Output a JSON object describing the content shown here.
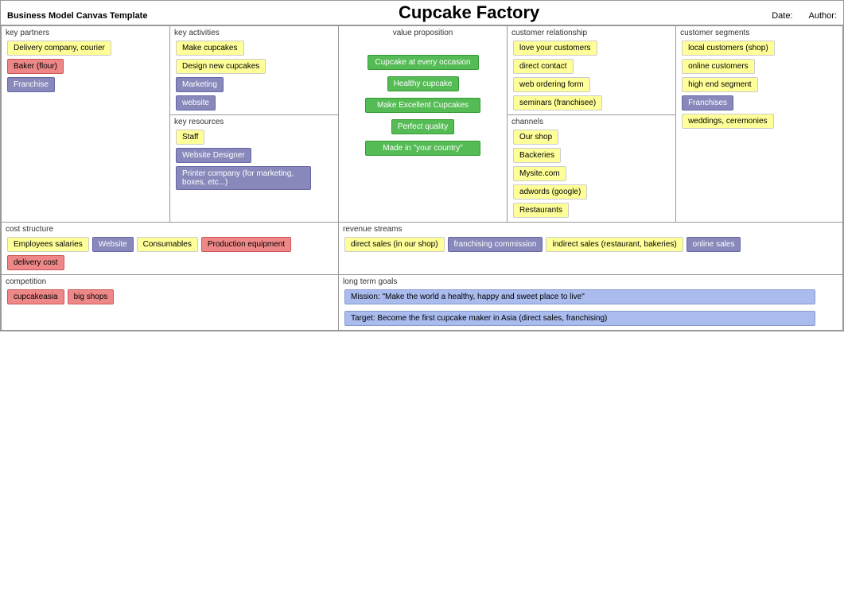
{
  "app": {
    "title": "Business Model Canvas Template"
  },
  "canvas": {
    "title": "Cupcake Factory",
    "date_label": "Date:",
    "author_label": "Author:"
  },
  "sections": {
    "key_partners": "key partners",
    "key_activities": "key activities",
    "value_proposition": "value proposition",
    "customer_relationship": "customer relationship",
    "customer_segments": "customer segments",
    "key_resources": "key resources",
    "channels": "channels",
    "cost_structure": "cost structure",
    "revenue_streams": "revenue streams",
    "competition": "competition",
    "long_term_goals": "long term goals"
  },
  "key_partners": [
    {
      "label": "Delivery company, courier",
      "type": "y"
    },
    {
      "label": "Baker (flour)",
      "type": "r"
    },
    {
      "label": "Franchise",
      "type": "b"
    }
  ],
  "key_activities": [
    {
      "label": "Make cupcakes",
      "type": "y"
    },
    {
      "label": "Design new cupcakes",
      "type": "y"
    },
    {
      "label": "Marketing",
      "type": "b"
    },
    {
      "label": "website",
      "type": "b"
    }
  ],
  "key_resources": [
    {
      "label": "Staff",
      "type": "y"
    },
    {
      "label": "Website Designer",
      "type": "b"
    },
    {
      "label": "Printer company (for marketing, boxes, etc...)",
      "type": "b"
    }
  ],
  "value_proposition": [
    {
      "label": "Cupcake at every occasion",
      "type": "g"
    },
    {
      "label": "Healthy cupcake",
      "type": "g"
    },
    {
      "label": "Make Excellent Cupcakes",
      "type": "g"
    },
    {
      "label": "Perfect quality",
      "type": "g"
    },
    {
      "label": "Made in \"your country\"",
      "type": "g"
    }
  ],
  "customer_relationship": [
    {
      "label": "love your customers",
      "type": "y"
    },
    {
      "label": "direct contact",
      "type": "y"
    },
    {
      "label": "web ordering form",
      "type": "y"
    },
    {
      "label": "seminars (franchisee)",
      "type": "y"
    }
  ],
  "customer_segments": [
    {
      "label": "local customers (shop)",
      "type": "y"
    },
    {
      "label": "online customers",
      "type": "y"
    },
    {
      "label": "high end segment",
      "type": "y"
    },
    {
      "label": "Franchises",
      "type": "b"
    },
    {
      "label": "weddings, ceremonies",
      "type": "y"
    }
  ],
  "channels": [
    {
      "label": "Our shop",
      "type": "y"
    },
    {
      "label": "Backeries",
      "type": "y"
    },
    {
      "label": "Mysite.com",
      "type": "y"
    },
    {
      "label": "adwords (google)",
      "type": "y"
    },
    {
      "label": "Restaurants",
      "type": "y"
    }
  ],
  "cost_structure": [
    {
      "label": "Employees salaries",
      "type": "y"
    },
    {
      "label": "Website",
      "type": "b"
    },
    {
      "label": "Consumables",
      "type": "y"
    },
    {
      "label": "Production equipment",
      "type": "r"
    },
    {
      "label": "delivery cost",
      "type": "r"
    }
  ],
  "revenue_streams": [
    {
      "label": "direct sales (in our shop)",
      "type": "y"
    },
    {
      "label": "franchising commission",
      "type": "b"
    },
    {
      "label": "indirect sales (restaurant, bakeries)",
      "type": "y"
    },
    {
      "label": "online sales",
      "type": "b"
    }
  ],
  "competition": [
    {
      "label": "cupcakeasia",
      "type": "r"
    },
    {
      "label": "big shops",
      "type": "r"
    }
  ],
  "long_term_goals": [
    {
      "label": "Mission: \"Make the world a healthy, happy and sweet place to live\"",
      "type": "lb"
    },
    {
      "label": "Target: Become the first cupcake maker in Asia (direct sales, franchising)",
      "type": "lb"
    }
  ]
}
